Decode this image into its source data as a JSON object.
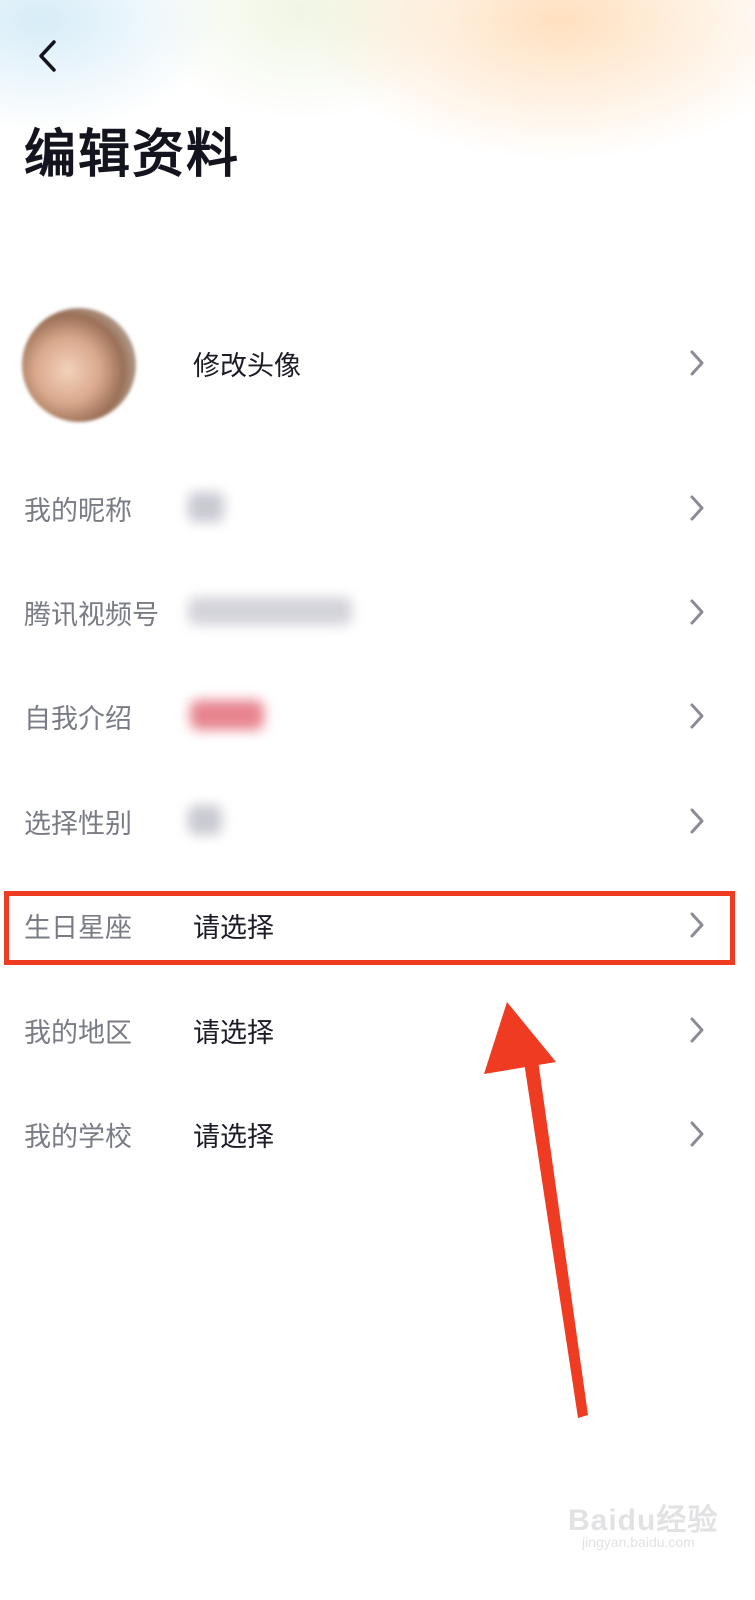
{
  "header": {
    "title": "编辑资料"
  },
  "avatar_row": {
    "label": "修改头像"
  },
  "rows": [
    {
      "label": "我的昵称",
      "value": ""
    },
    {
      "label": "腾讯视频号",
      "value": ""
    },
    {
      "label": "自我介绍",
      "value": ""
    },
    {
      "label": "选择性别",
      "value": ""
    },
    {
      "label": "生日星座",
      "value": "请选择"
    },
    {
      "label": "我的地区",
      "value": "请选择"
    },
    {
      "label": "我的学校",
      "value": "请选择"
    }
  ],
  "colors": {
    "highlight": "#ee3b22",
    "label": "#7a7c85",
    "value": "#1c1c26"
  },
  "icons": {
    "back": "chevron-left-icon",
    "row": "chevron-right-icon"
  },
  "watermark": {
    "brand": "Baidu经验",
    "url": "jingyan.baidu.com"
  }
}
